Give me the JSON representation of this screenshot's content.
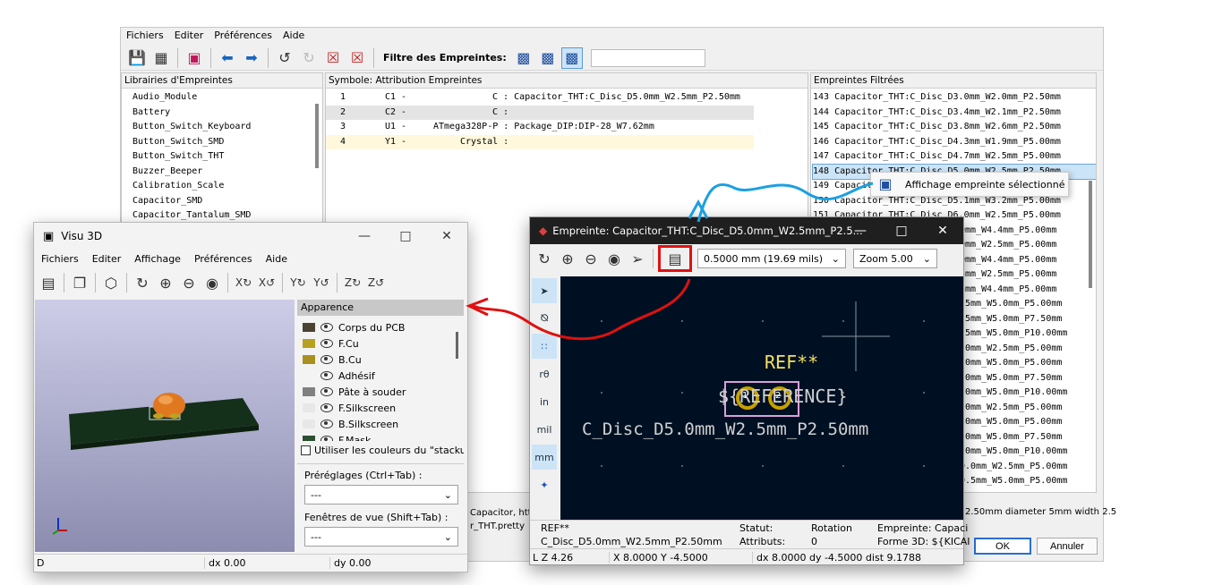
{
  "main": {
    "menu": [
      "Fichiers",
      "Editer",
      "Préférences",
      "Aide"
    ],
    "filter_label": "Filtre des Empreintes:",
    "libs_header": "Librairies d'Empreintes",
    "libs": [
      "Audio_Module",
      "Battery",
      "Button_Switch_Keyboard",
      "Button_Switch_SMD",
      "Button_Switch_THT",
      "Buzzer_Beeper",
      "Calibration_Scale",
      "Capacitor_SMD",
      "Capacitor_Tantalum_SMD"
    ],
    "sym_header": "Symbole: Attribution Empreintes",
    "symbols": [
      {
        "num": "1",
        "ref": "C1 -",
        "val": "C : Capacitor_THT:C_Disc_D5.0mm_W2.5mm_P2.50mm"
      },
      {
        "num": "2",
        "ref": "C2 -",
        "val": "C :"
      },
      {
        "num": "3",
        "ref": "U1 -",
        "val": "ATmega328P-P : Package_DIP:DIP-28_W7.62mm"
      },
      {
        "num": "4",
        "ref": "Y1 -",
        "val": "Crystal :"
      }
    ],
    "filt_header": "Empreintes Filtrées",
    "filtered": [
      "143 Capacitor_THT:C_Disc_D3.0mm_W2.0mm_P2.50mm",
      "144 Capacitor_THT:C_Disc_D3.4mm_W2.1mm_P2.50mm",
      "145 Capacitor_THT:C_Disc_D3.8mm_W2.6mm_P2.50mm",
      "146 Capacitor_THT:C_Disc_D4.3mm_W1.9mm_P5.00mm",
      "147 Capacitor_THT:C_Disc_D4.7mm_W2.5mm_P5.00mm",
      "148 Capacitor_THT:C_Disc_D5.0mm_W2.5mm_P2.50mm",
      "149 Capacitor_THT:C_Disc_D5.0mm_W2.5mm_P5.00mm",
      "150 Capacitor_THT:C_Disc_D5.1mm_W3.2mm_P5.00mm",
      "151 Capacitor_THT:C_Disc_D6.0mm_W2.5mm_P5.00mm"
    ],
    "filtered_tail": [
      "0mm_W4.4mm_P5.00mm",
      "0mm_W2.5mm_P5.00mm",
      "0mm_W4.4mm_P5.00mm",
      "5mm_W2.5mm_P5.00mm",
      "5mm_W4.4mm_P5.00mm",
      ".5mm_W5.0mm_P5.00mm",
      ".5mm_W5.0mm_P7.50mm",
      ".5mm_W5.0mm_P10.00mm",
      ".0mm_W2.5mm_P5.00mm",
      ".0mm_W5.0mm_P5.00mm",
      ".0mm_W5.0mm_P7.50mm",
      ".0mm_W5.0mm_P10.00mm",
      ".0mm_W2.5mm_P5.00mm",
      ".0mm_W5.0mm_P5.00mm",
      ".0mm_W5.0mm_P7.50mm",
      ".0mm_W5.0mm_P10.00mm",
      "0.0mm_W2.5mm_P5.00mm",
      "0.5mm_W5.0mm_P5.00mm"
    ],
    "context_menu": "Affichage empreinte sélectionné",
    "status_left1": "Capacitor, http",
    "status_left2": "r_THT.pretty",
    "status_right": "2.50mm  diameter 5mm width 2.5",
    "ok": "OK",
    "cancel": "Annuler"
  },
  "win3d": {
    "title": "Visu 3D",
    "menu": [
      "Fichiers",
      "Editer",
      "Affichage",
      "Préférences",
      "Aide"
    ],
    "appearance": "Apparence",
    "layers": [
      {
        "name": "Corps du PCB",
        "color": "#4a4232"
      },
      {
        "name": "F.Cu",
        "color": "#b8a020"
      },
      {
        "name": "B.Cu",
        "color": "#a89020"
      },
      {
        "name": "Adhésif",
        "color": ""
      },
      {
        "name": "Pâte à souder",
        "color": "#808080"
      },
      {
        "name": "F.Silkscreen",
        "color": "#e8e8e8"
      },
      {
        "name": "B.Silkscreen",
        "color": "#e8e8e8"
      },
      {
        "name": "F.Mask",
        "color": "#2a5030"
      }
    ],
    "stackup_cb": "Utiliser les couleurs du \"stackup\"",
    "presets_label": "Préréglages (Ctrl+Tab) :",
    "presets_value": "---",
    "views_label": "Fenêtres de vue (Shift+Tab) :",
    "views_value": "---",
    "status": [
      "D",
      "dx 0.00",
      "dy 0.00"
    ]
  },
  "winfp": {
    "title": "Empreinte: Capacitor_THT:C_Disc_D5.0mm_W2.5mm_P2.5...",
    "grid": "0.5000 mm (19.69 mils)",
    "zoom": "Zoom 5.00",
    "side_tools": [
      "in",
      "mil",
      "mm"
    ],
    "ref_text": "REF**",
    "value_text": "${REFERENCE}",
    "fp_name": "C_Disc_D5.0mm_W2.5mm_P2.50mm",
    "pad1": "1",
    "pad2": "2",
    "info": {
      "ref": "REF**",
      "name": "C_Disc_D5.0mm_W2.5mm_P2.50mm",
      "statut": "Statut:",
      "attributs": "Attributs:",
      "rotation": "Rotation",
      "rot_val": "0",
      "empreinte": "Empreinte: Capaci",
      "forme3d": "Forme 3D: ${KICAI"
    },
    "status": [
      "L  Z 4.26",
      "X 8.0000  Y -4.5000",
      "dx 8.0000  dy -4.5000  dist 9.1788"
    ]
  },
  "colors": {
    "accent_red": "#e01010",
    "accent_blue": "#1ba0e0",
    "canvas_bg": "#001023",
    "pad": "#c8a000"
  }
}
